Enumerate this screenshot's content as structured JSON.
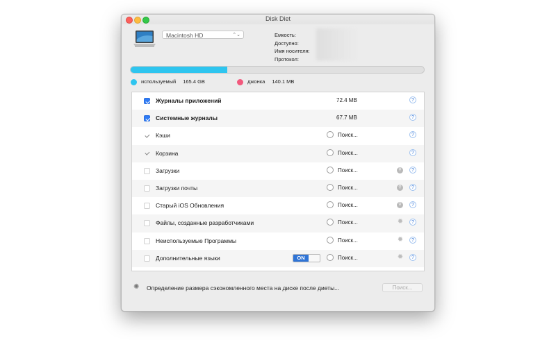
{
  "window": {
    "title": "Disk Diet"
  },
  "disk": {
    "selected": "Macintosh HD",
    "labels": [
      "Емкость:",
      "Доступно:",
      "Имя носителя:",
      "Протокол:"
    ]
  },
  "usage": {
    "used_fraction": 0.33,
    "used_label": "используемый",
    "used_value": "165.4 GB",
    "junk_label": "джонка",
    "junk_value": "140.1 MB",
    "used_color": "#2ec5ef",
    "junk_color": "#f2597d"
  },
  "items": [
    {
      "label": "Журналы приложений",
      "checkbox": "checked",
      "bold": true,
      "size": "72.4 MB",
      "searching": false,
      "action_icon": "",
      "toggle": "",
      "help": "?"
    },
    {
      "label": "Системные журналы",
      "checkbox": "checked",
      "bold": true,
      "size": "67.7 MB",
      "searching": false,
      "action_icon": "",
      "toggle": "",
      "help": "?"
    },
    {
      "label": "Кэши",
      "checkbox": "gray",
      "bold": false,
      "size": "",
      "searching": true,
      "search_text": "Поиск...",
      "action_icon": "",
      "toggle": "",
      "help": "?"
    },
    {
      "label": "Корзина",
      "checkbox": "gray",
      "bold": false,
      "size": "",
      "searching": true,
      "search_text": "Поиск...",
      "action_icon": "",
      "toggle": "",
      "help": "?"
    },
    {
      "label": "Загрузки",
      "checkbox": "empty",
      "bold": false,
      "size": "",
      "searching": true,
      "search_text": "Поиск...",
      "action_icon": "magnifier-icon",
      "toggle": "",
      "help": "?"
    },
    {
      "label": "Загрузки почты",
      "checkbox": "empty",
      "bold": false,
      "size": "",
      "searching": true,
      "search_text": "Поиск...",
      "action_icon": "magnifier-icon",
      "toggle": "",
      "help": "?"
    },
    {
      "label": "Старый iOS Обновления",
      "checkbox": "empty",
      "bold": false,
      "size": "",
      "searching": true,
      "search_text": "Поиск...",
      "action_icon": "magnifier-icon",
      "toggle": "",
      "help": "?"
    },
    {
      "label": "Файлы, созданные разработчиками",
      "checkbox": "empty",
      "bold": false,
      "size": "",
      "searching": true,
      "search_text": "Поиск...",
      "action_icon": "gear-icon",
      "toggle": "",
      "help": "?"
    },
    {
      "label": "Неиспользуемые Программы",
      "checkbox": "empty",
      "bold": false,
      "size": "",
      "searching": true,
      "search_text": "Поиск...",
      "action_icon": "gear-icon",
      "toggle": "",
      "help": "?"
    },
    {
      "label": "Дополнительные языки",
      "checkbox": "empty",
      "bold": false,
      "size": "",
      "searching": true,
      "search_text": "Поиск...",
      "action_icon": "gear-icon",
      "toggle": "ON",
      "help": "?"
    }
  ],
  "status": {
    "text": "Определение размера сэкономленного места на диске после диеты...",
    "button": "Поиск..."
  }
}
